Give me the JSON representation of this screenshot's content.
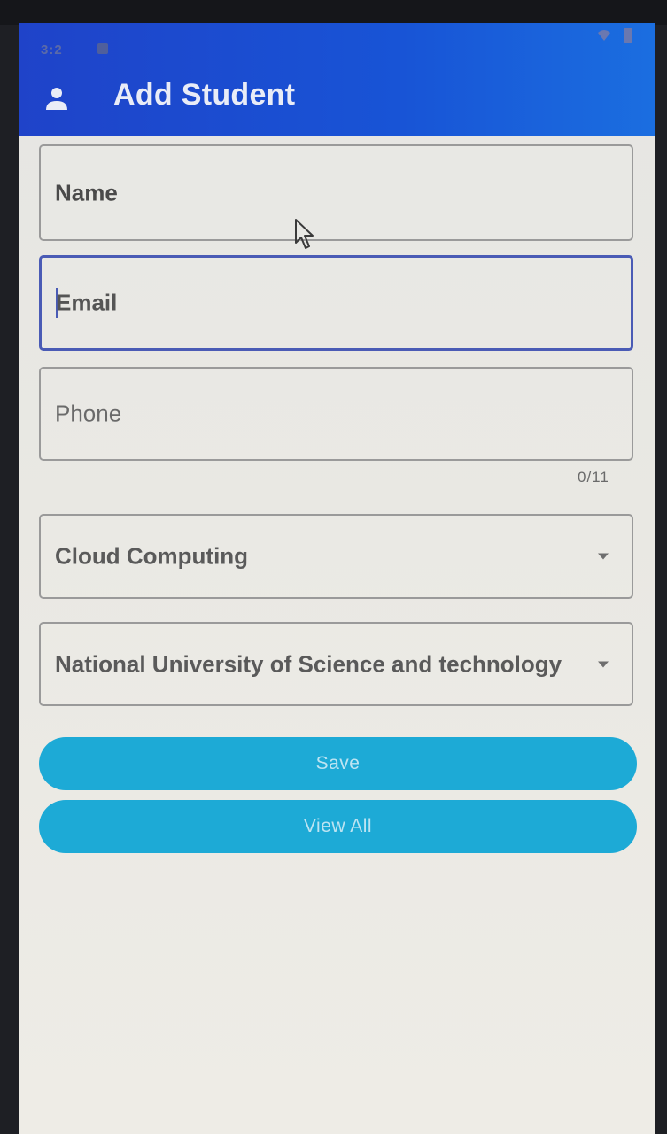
{
  "status_bar": {
    "time": "3:2",
    "notification_icon": "notification-icon",
    "wifi_icon": "wifi-icon",
    "battery_icon": "battery-icon"
  },
  "app_bar": {
    "icon": "account-icon",
    "title": "Add Student",
    "color": "#1f4fd0"
  },
  "form": {
    "name": {
      "placeholder": "Name",
      "value": ""
    },
    "email": {
      "placeholder": "Email",
      "value": ""
    },
    "phone": {
      "placeholder": "Phone",
      "value": "",
      "counter": "0/11"
    },
    "course_select": {
      "selected": "Cloud Computing"
    },
    "university_select": {
      "selected": "National University of Science and technology"
    }
  },
  "buttons": {
    "save_label": "Save",
    "view_all_label": "View All",
    "color": "#1daad6"
  }
}
